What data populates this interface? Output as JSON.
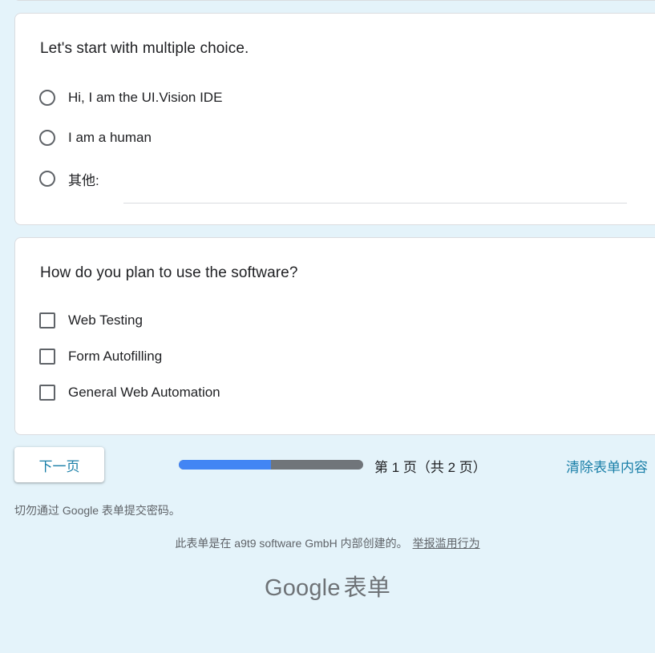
{
  "question1": {
    "title": "Let's start with multiple choice.",
    "options": [
      {
        "label": "Hi, I am the UI.Vision IDE"
      },
      {
        "label": "I am a human"
      },
      {
        "label": "其他:"
      }
    ],
    "other_value": ""
  },
  "question2": {
    "title": "How do you plan to use the software?",
    "options": [
      {
        "label": "Web Testing"
      },
      {
        "label": "Form Autofilling"
      },
      {
        "label": "General Web Automation"
      }
    ]
  },
  "navigation": {
    "next_label": "下一页",
    "page_text": "第 1 页（共 2 页）",
    "progress_fraction": 0.5,
    "clear_label": "清除表单内容"
  },
  "footer": {
    "warning": "切勿通过 Google 表单提交密码。",
    "created_text": "此表单是在 a9t9 software GmbH 内部创建的。",
    "report_link": "举报滥用行为",
    "brand_word": "Google",
    "brand_suffix": "表单"
  },
  "colors": {
    "background": "#e4f3fa",
    "accent": "#1a7fa8",
    "progress": "#4285f4"
  }
}
